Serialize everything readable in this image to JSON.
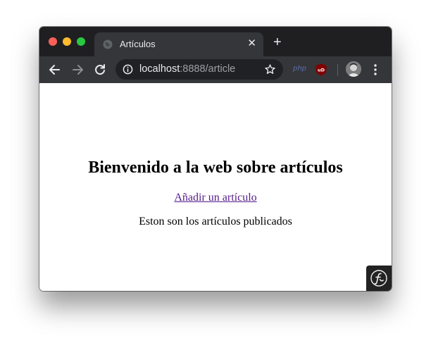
{
  "window": {
    "tab": {
      "title": "Artículos",
      "close_glyph": "✕"
    },
    "new_tab_glyph": "+"
  },
  "toolbar": {
    "url_host": "localhost",
    "url_rest": ":8888/article",
    "extensions": {
      "php_label": "php",
      "ublock_label": "uD"
    }
  },
  "page": {
    "heading": "Bienvenido a la web sobre artículos",
    "add_link": "Añadir un artículo",
    "subtitle": "Eston son los artículos publicados"
  },
  "icons": {
    "back": "arrow-left-icon",
    "forward": "arrow-right-icon",
    "reload": "reload-icon",
    "info": "info-icon",
    "star": "star-icon",
    "menu": "kebab-menu-icon",
    "symfony": "symfony-logo-icon"
  },
  "colors": {
    "tabbar": "#1f1f22",
    "toolbar": "#35363a",
    "omnibox": "#202124",
    "link": "#551a8b",
    "traffic_red": "#ff5f57",
    "traffic_yellow": "#febc2e",
    "traffic_green": "#28c840"
  }
}
